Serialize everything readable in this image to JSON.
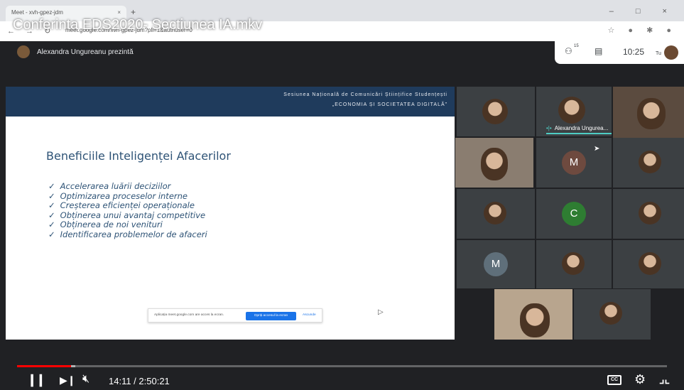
{
  "video": {
    "title": "Conferinta EDS2020- Sectiunea IA.mkv"
  },
  "browser": {
    "tab_title": "Meet - xvh-gpez-jdm",
    "tab_close": "× ",
    "new_tab": "+",
    "url": "meet.google.com/xvh-gpez-jdm?pli=1&authuser=0",
    "window_controls": "– □ ×"
  },
  "meet": {
    "presenter_label": "Alexandra Ungureanu prezintă",
    "people_count": "15",
    "clock": "10:25",
    "self_label": "Tu"
  },
  "slide": {
    "header_line1": "Sesiunea Națională de Comunicări Științifice Studențești",
    "header_line2": "„ECONOMIA ȘI SOCIETATEA DIGITALĂ”",
    "title": "Beneficiile Inteligenței Afacerilor",
    "bullets": [
      "Accelerarea luării deciziilor",
      "Optimizarea proceselor interne",
      "Creșterea eficienței operaționale",
      "Obținerea unui avantaj competitive",
      "Obținerea de noi venituri",
      "Identificarea problemelor de afaceri"
    ],
    "bullet_mark": "✓"
  },
  "share_notice": {
    "text": "Aplicația meet.google.com are acces la ecran.",
    "button_label": "Opriți accesul la ecran",
    "hide_label": "Ascunde"
  },
  "participants": {
    "speaker_name": "Alexandra Ungurea...",
    "speaker_eq": "•|•",
    "letters": [
      "M",
      "C",
      "M"
    ],
    "colors": {
      "m_avatar": "#6e4a3f",
      "c_avatar": "#2e7d32",
      "m2_avatar": "#5f6f7a"
    }
  },
  "player": {
    "time": "14:11 / 2:50:21",
    "progress_fraction": 0.083,
    "buffer_fraction": 0.09,
    "cc_label": "CC",
    "accent_color": "#ff0000"
  }
}
